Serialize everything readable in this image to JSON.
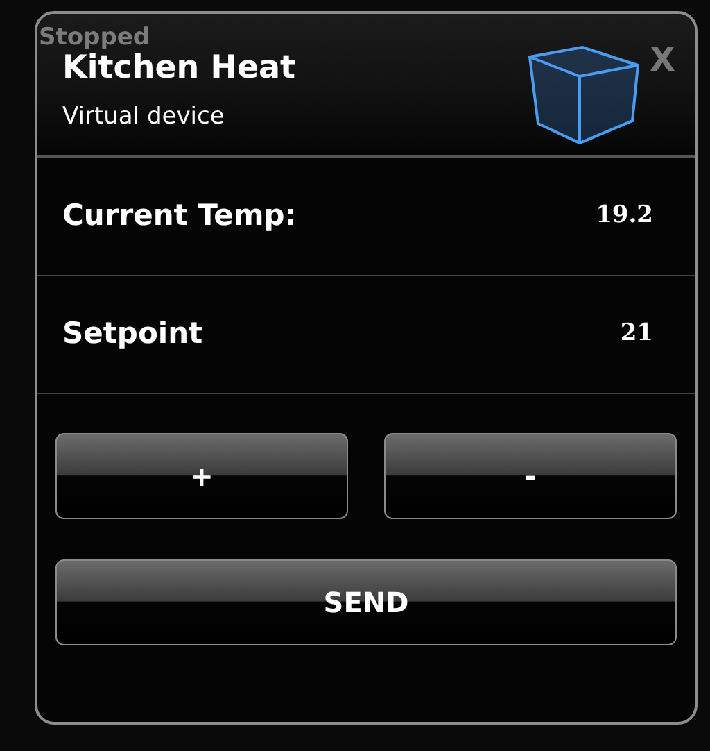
{
  "background": {
    "status": "Stopped"
  },
  "dialog": {
    "title": "Kitchen Heat",
    "subtitle": "Virtual device",
    "close": "X",
    "rows": [
      {
        "label": "Current Temp:",
        "value": "19.2"
      },
      {
        "label": "Setpoint",
        "value": "21"
      }
    ],
    "buttons": [
      {
        "label": "+",
        "kind": "small"
      },
      {
        "label": "-",
        "kind": "small"
      },
      {
        "label": "SEND",
        "kind": "wide"
      }
    ]
  }
}
